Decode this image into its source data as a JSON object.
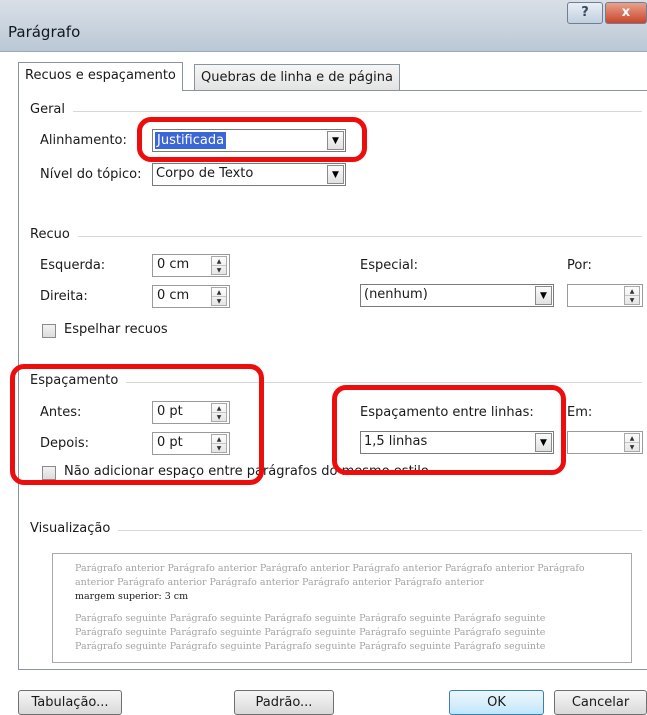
{
  "window": {
    "title": "Parágrafo",
    "help_glyph": "?",
    "close_glyph": "x"
  },
  "tabs": [
    {
      "label": "Recuos e espaçamento"
    },
    {
      "label": "Quebras de linha e de página"
    }
  ],
  "geral": {
    "heading": "Geral",
    "alinhamento_label": "Alinhamento:",
    "alinhamento_value": "Justificada",
    "nivel_label": "Nível do tópico:",
    "nivel_value": "Corpo de Texto"
  },
  "recuo": {
    "heading": "Recuo",
    "esquerda_label": "Esquerda:",
    "esquerda_value": "0 cm",
    "direita_label": "Direita:",
    "direita_value": "0 cm",
    "especial_label": "Especial:",
    "especial_value": "(nenhum)",
    "por_label": "Por:",
    "por_value": "",
    "espelhar_label": "Espelhar recuos"
  },
  "espacamento": {
    "heading": "Espaçamento",
    "antes_label": "Antes:",
    "antes_value": "0 pt",
    "depois_label": "Depois:",
    "depois_value": "0 pt",
    "entre_linhas_label": "Espaçamento entre linhas:",
    "entre_linhas_value": "1,5 linhas",
    "em_label": "Em:",
    "em_value": "",
    "nao_adicionar_label": "Não adicionar espaço entre parágrafos do mesmo estilo"
  },
  "visualizacao": {
    "heading": "Visualização",
    "anterior_line1": "Parágrafo anterior Parágrafo anterior Parágrafo anterior Parágrafo anterior Parágrafo anterior Parágrafo",
    "anterior_line2": "anterior Parágrafo anterior Parágrafo anterior Parágrafo anterior Parágrafo anterior",
    "current": "margem superior: 3 cm",
    "seguinte_line1": "Parágrafo seguinte Parágrafo seguinte Parágrafo seguinte Parágrafo seguinte Parágrafo seguinte",
    "seguinte_line2": "Parágrafo seguinte Parágrafo seguinte Parágrafo seguinte Parágrafo seguinte Parágrafo seguinte",
    "seguinte_line3": "Parágrafo seguinte Parágrafo seguinte Parágrafo seguinte Parágrafo seguinte Parágrafo seguinte"
  },
  "buttons": {
    "tabulacao": "Tabulação...",
    "padrao": "Padrão...",
    "ok": "OK",
    "cancelar": "Cancelar"
  },
  "colors": {
    "highlight_ring": "#ee0d0d",
    "selection": "#3b66d6"
  }
}
